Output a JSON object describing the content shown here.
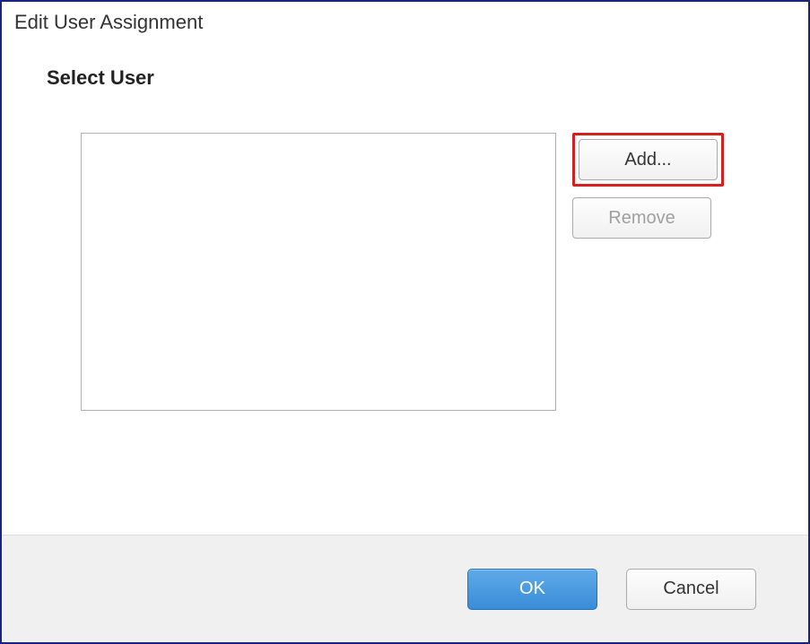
{
  "dialog": {
    "title": "Edit User Assignment"
  },
  "section": {
    "heading": "Select User"
  },
  "buttons": {
    "add": "Add...",
    "remove": "Remove",
    "ok": "OK",
    "cancel": "Cancel"
  },
  "state": {
    "remove_enabled": false,
    "add_highlighted": true
  }
}
